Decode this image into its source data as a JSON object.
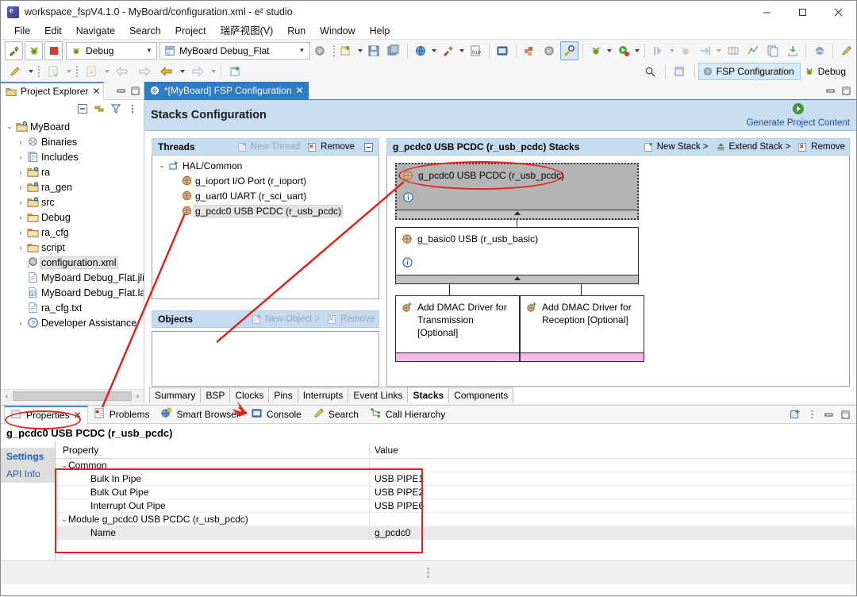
{
  "window": {
    "title": "workspace_fspV4.1.0 - MyBoard/configuration.xml - e² studio",
    "minimize": "─",
    "maximize": "□",
    "close": "✕"
  },
  "menu": [
    "File",
    "Edit",
    "Navigate",
    "Search",
    "Project",
    "瑞萨视图(V)",
    "Run",
    "Window",
    "Help"
  ],
  "toolbar": {
    "debug_config_value": "Debug",
    "launch_config_value": "MyBoard Debug_Flat",
    "perspective_fsp": "FSP Configuration",
    "perspective_debug": "Debug"
  },
  "project_explorer": {
    "tab_label": "Project Explorer",
    "tree": [
      {
        "label": "MyBoard",
        "depth": 0,
        "twisty": "⌄",
        "icon": "project-icon",
        "selected": false
      },
      {
        "label": "Binaries",
        "depth": 1,
        "twisty": "›",
        "icon": "binaries-icon",
        "selected": false
      },
      {
        "label": "Includes",
        "depth": 1,
        "twisty": "›",
        "icon": "includes-icon",
        "selected": false
      },
      {
        "label": "ra",
        "depth": 1,
        "twisty": "›",
        "icon": "src-folder-icon",
        "selected": false
      },
      {
        "label": "ra_gen",
        "depth": 1,
        "twisty": "›",
        "icon": "src-folder-icon",
        "selected": false
      },
      {
        "label": "src",
        "depth": 1,
        "twisty": "›",
        "icon": "src-folder-icon",
        "selected": false
      },
      {
        "label": "Debug",
        "depth": 1,
        "twisty": "›",
        "icon": "folder-icon",
        "selected": false
      },
      {
        "label": "ra_cfg",
        "depth": 1,
        "twisty": "›",
        "icon": "folder-icon",
        "selected": false
      },
      {
        "label": "script",
        "depth": 1,
        "twisty": "›",
        "icon": "folder-icon",
        "selected": false
      },
      {
        "label": "configuration.xml",
        "depth": 1,
        "twisty": "",
        "icon": "config-xml-icon",
        "selected": true
      },
      {
        "label": "MyBoard Debug_Flat.jlink",
        "depth": 1,
        "twisty": "",
        "icon": "file-icon",
        "selected": false
      },
      {
        "label": "MyBoard Debug_Flat.laun",
        "depth": 1,
        "twisty": "",
        "icon": "launch-file-icon",
        "selected": false
      },
      {
        "label": "ra_cfg.txt",
        "depth": 1,
        "twisty": "",
        "icon": "file-icon",
        "selected": false
      },
      {
        "label": "Developer Assistance",
        "depth": 1,
        "twisty": "›",
        "icon": "help-icon",
        "selected": false
      }
    ]
  },
  "editor": {
    "tab_label": "*[MyBoard] FSP Configuration",
    "banner_title": "Stacks Configuration",
    "generate_link": "Generate Project Content",
    "threads": {
      "title": "Threads",
      "new_thread": "New Thread",
      "remove": "Remove",
      "items": [
        {
          "label": "HAL/Common",
          "depth": 0,
          "twisty": "⌄",
          "icon": "hal-icon",
          "selected": false
        },
        {
          "label": "g_ioport I/O Port (r_ioport)",
          "depth": 1,
          "twisty": "",
          "icon": "module-icon",
          "selected": false
        },
        {
          "label": "g_uart0 UART (r_sci_uart)",
          "depth": 1,
          "twisty": "",
          "icon": "module-icon",
          "selected": false
        },
        {
          "label": "g_pcdc0 USB PCDC (r_usb_pcdc)",
          "depth": 1,
          "twisty": "",
          "icon": "module-icon",
          "selected": true
        }
      ]
    },
    "objects": {
      "title": "Objects",
      "new_object": "New Object >",
      "remove": "Remove"
    },
    "stacks": {
      "title": "g_pcdc0 USB PCDC (r_usb_pcdc) Stacks",
      "new_stack": "New Stack >",
      "extend_stack": "Extend Stack >",
      "remove": "Remove",
      "node_top": "g_pcdc0 USB PCDC (r_usb_pcdc)",
      "node_mid": "g_basic0 USB (r_usb_basic)",
      "node_dmac_tx": "Add DMAC Driver for Transmission [Optional]",
      "node_dmac_rx": "Add DMAC Driver for Reception [Optional]"
    },
    "bottom_tabs": [
      {
        "label": "Summary",
        "selected": false
      },
      {
        "label": "BSP",
        "selected": false
      },
      {
        "label": "Clocks",
        "selected": false
      },
      {
        "label": "Pins",
        "selected": false
      },
      {
        "label": "Interrupts",
        "selected": false
      },
      {
        "label": "Event Links",
        "selected": false
      },
      {
        "label": "Stacks",
        "selected": true
      },
      {
        "label": "Components",
        "selected": false
      }
    ]
  },
  "properties": {
    "tabs": [
      {
        "label": "Properties",
        "icon": "properties-icon",
        "selected": true
      },
      {
        "label": "Problems",
        "icon": "problems-icon",
        "selected": false
      },
      {
        "label": "Smart Browser",
        "icon": "smart-browser-icon",
        "selected": false
      },
      {
        "label": "Console",
        "icon": "console-icon",
        "selected": false
      },
      {
        "label": "Search",
        "icon": "search-icon",
        "selected": false
      },
      {
        "label": "Call Hierarchy",
        "icon": "call-hierarchy-icon",
        "selected": false
      }
    ],
    "title": "g_pcdc0 USB PCDC (r_usb_pcdc)",
    "side_tabs": [
      "Settings",
      "API Info"
    ],
    "columns": [
      "Property",
      "Value"
    ],
    "rows": [
      {
        "property": "Common",
        "value": "",
        "group": true,
        "indent": 0,
        "alt": false
      },
      {
        "property": "Bulk In Pipe",
        "value": "USB PIPE1",
        "group": false,
        "indent": 1,
        "alt": false
      },
      {
        "property": "Bulk Out Pipe",
        "value": "USB PIPE2",
        "group": false,
        "indent": 1,
        "alt": false
      },
      {
        "property": "Interrupt Out Pipe",
        "value": "USB PIPE6",
        "group": false,
        "indent": 1,
        "alt": false
      },
      {
        "property": "Module g_pcdc0 USB PCDC (r_usb_pcdc)",
        "value": "",
        "group": true,
        "indent": 0,
        "alt": false
      },
      {
        "property": "Name",
        "value": "g_pcdc0",
        "group": false,
        "indent": 1,
        "alt": true
      }
    ]
  },
  "annotation": {
    "color": "#e0251b"
  }
}
